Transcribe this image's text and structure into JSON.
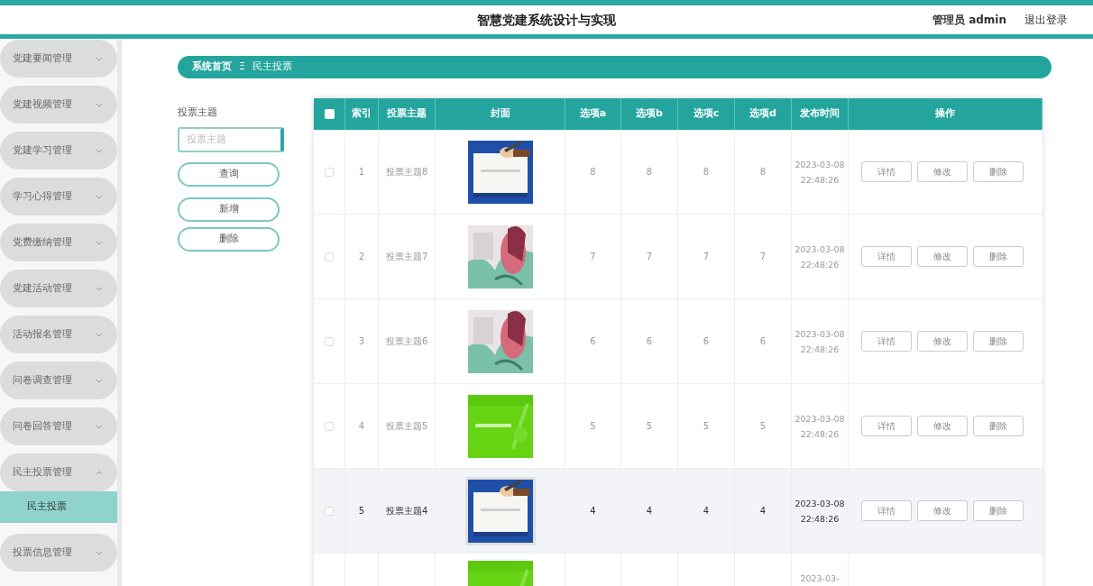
{
  "header": {
    "title": "智慧党建系统设计与实现",
    "user": "管理员 admin",
    "logout": "退出登录"
  },
  "sidebar": {
    "items": [
      {
        "label": "党建要闻管理",
        "expanded": false
      },
      {
        "label": "党建视频管理",
        "expanded": false
      },
      {
        "label": "党建学习管理",
        "expanded": false
      },
      {
        "label": "学习心得管理",
        "expanded": false
      },
      {
        "label": "党费缴纳管理",
        "expanded": false
      },
      {
        "label": "党建活动管理",
        "expanded": false
      },
      {
        "label": "活动报名管理",
        "expanded": false
      },
      {
        "label": "问卷调查管理",
        "expanded": false
      },
      {
        "label": "问卷回答管理",
        "expanded": false
      },
      {
        "label": "民主投票管理",
        "expanded": true,
        "children": [
          {
            "label": "民主投票",
            "selected": true
          }
        ]
      },
      {
        "label": "投票信息管理",
        "expanded": false
      }
    ]
  },
  "breadcrumb": {
    "home": "系统首页",
    "separator": "Ξ",
    "current": "民主投票"
  },
  "search": {
    "label": "投票主题",
    "placeholder": "投票主题",
    "buttons": [
      "查询",
      "新增",
      "删除"
    ]
  },
  "table": {
    "header_checked": false,
    "columns": [
      "索引",
      "投票主题",
      "封面",
      "选项a",
      "选项b",
      "选项c",
      "选项d",
      "发布时间",
      "操作"
    ],
    "rows": [
      {
        "checked": false,
        "highlighted": false,
        "index": "1",
        "subject": "投票主题8",
        "a": "8",
        "b": "8",
        "c": "8",
        "d": "8",
        "time": "2023-03-08 22:48:26",
        "actions": [
          "详情",
          "修改",
          "删除"
        ]
      },
      {
        "checked": false,
        "highlighted": false,
        "index": "2",
        "subject": "投票主题7",
        "a": "7",
        "b": "7",
        "c": "7",
        "d": "7",
        "time": "2023-03-08 22:48:26",
        "actions": [
          "详情",
          "修改",
          "删除"
        ]
      },
      {
        "checked": false,
        "highlighted": false,
        "index": "3",
        "subject": "投票主题6",
        "a": "6",
        "b": "6",
        "c": "6",
        "d": "6",
        "time": "2023-03-08 22:48:26",
        "actions": [
          "详情",
          "修改",
          "删除"
        ]
      },
      {
        "checked": false,
        "highlighted": false,
        "index": "4",
        "subject": "投票主题5",
        "a": "5",
        "b": "5",
        "c": "5",
        "d": "5",
        "time": "2023-03-08 22:48:26",
        "actions": [
          "详情",
          "修改",
          "删除"
        ]
      },
      {
        "checked": false,
        "highlighted": true,
        "index": "5",
        "subject": "投票主题4",
        "a": "4",
        "b": "4",
        "c": "4",
        "d": "4",
        "time": "2023-03-08 22:48:26",
        "actions": [
          "详情",
          "修改",
          "删除"
        ]
      }
    ],
    "partial_row": {
      "time": "2023-03-"
    }
  }
}
